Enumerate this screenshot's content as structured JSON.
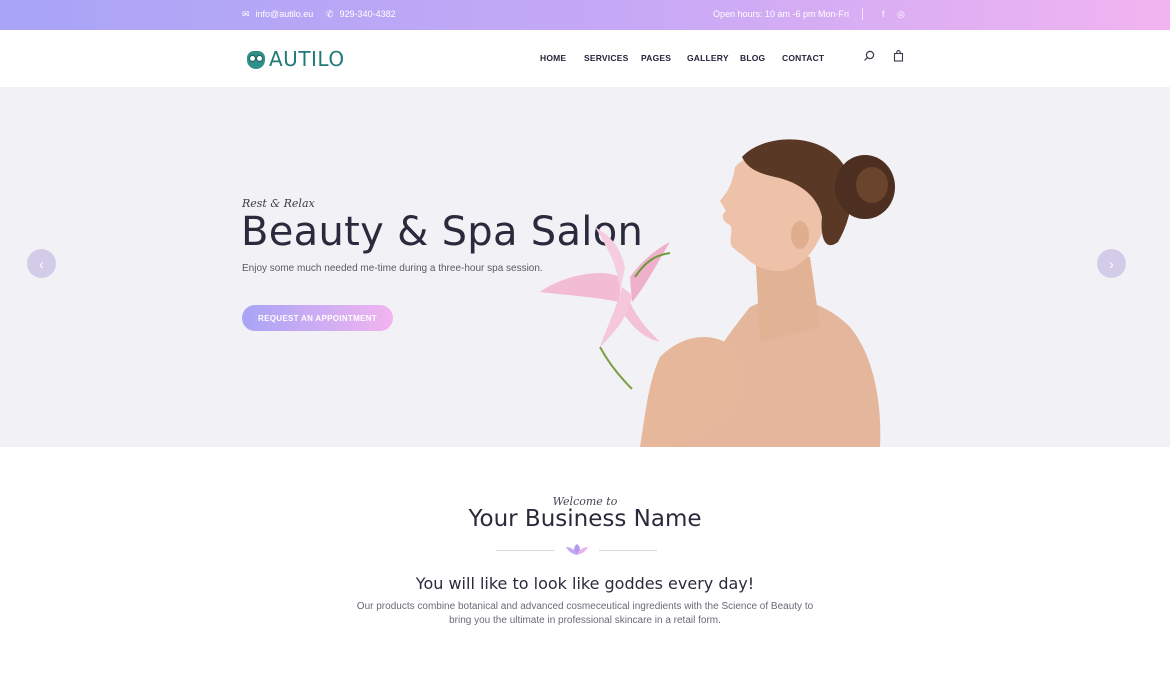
{
  "topbar": {
    "email": "info@autilo.eu",
    "phone": "929-340-4382",
    "hours": "Open hours: 10 am -6 pm Mon-Fri",
    "email_icon": "envelope-icon",
    "phone_icon": "phone-icon",
    "social": [
      {
        "name": "facebook-icon",
        "glyph": "f"
      },
      {
        "name": "instagram-icon",
        "glyph": "◎"
      }
    ]
  },
  "header": {
    "logo_text": "AUTILO",
    "nav": [
      "HOME",
      "SERVICES",
      "PAGES",
      "GALLERY",
      "BLOG",
      "CONTACT"
    ],
    "search_icon": "search-icon",
    "cart_icon": "shopping-bag-icon"
  },
  "hero": {
    "script": "Rest & Relax",
    "title": "Beauty & Spa Salon",
    "subtitle": "Enjoy some much needed me-time during a three-hour spa session.",
    "cta": "REQUEST AN APPOINTMENT",
    "prev_icon": "chevron-left-icon",
    "next_icon": "chevron-right-icon"
  },
  "welcome": {
    "script": "Welcome to",
    "title": "Your Business Name",
    "tagline": "You will like to look like goddes every day!",
    "description": "Our products combine botanical and advanced cosmeceutical ingredients with the Science of Beauty to bring you the ultimate in professional skincare in a retail form.",
    "divider_icon": "lotus-icon"
  },
  "colors": {
    "gradient_start": "#a8a4f6",
    "gradient_end": "#f2b4f0",
    "logo": "#227a78",
    "hero_bg": "#f2f1f6"
  }
}
